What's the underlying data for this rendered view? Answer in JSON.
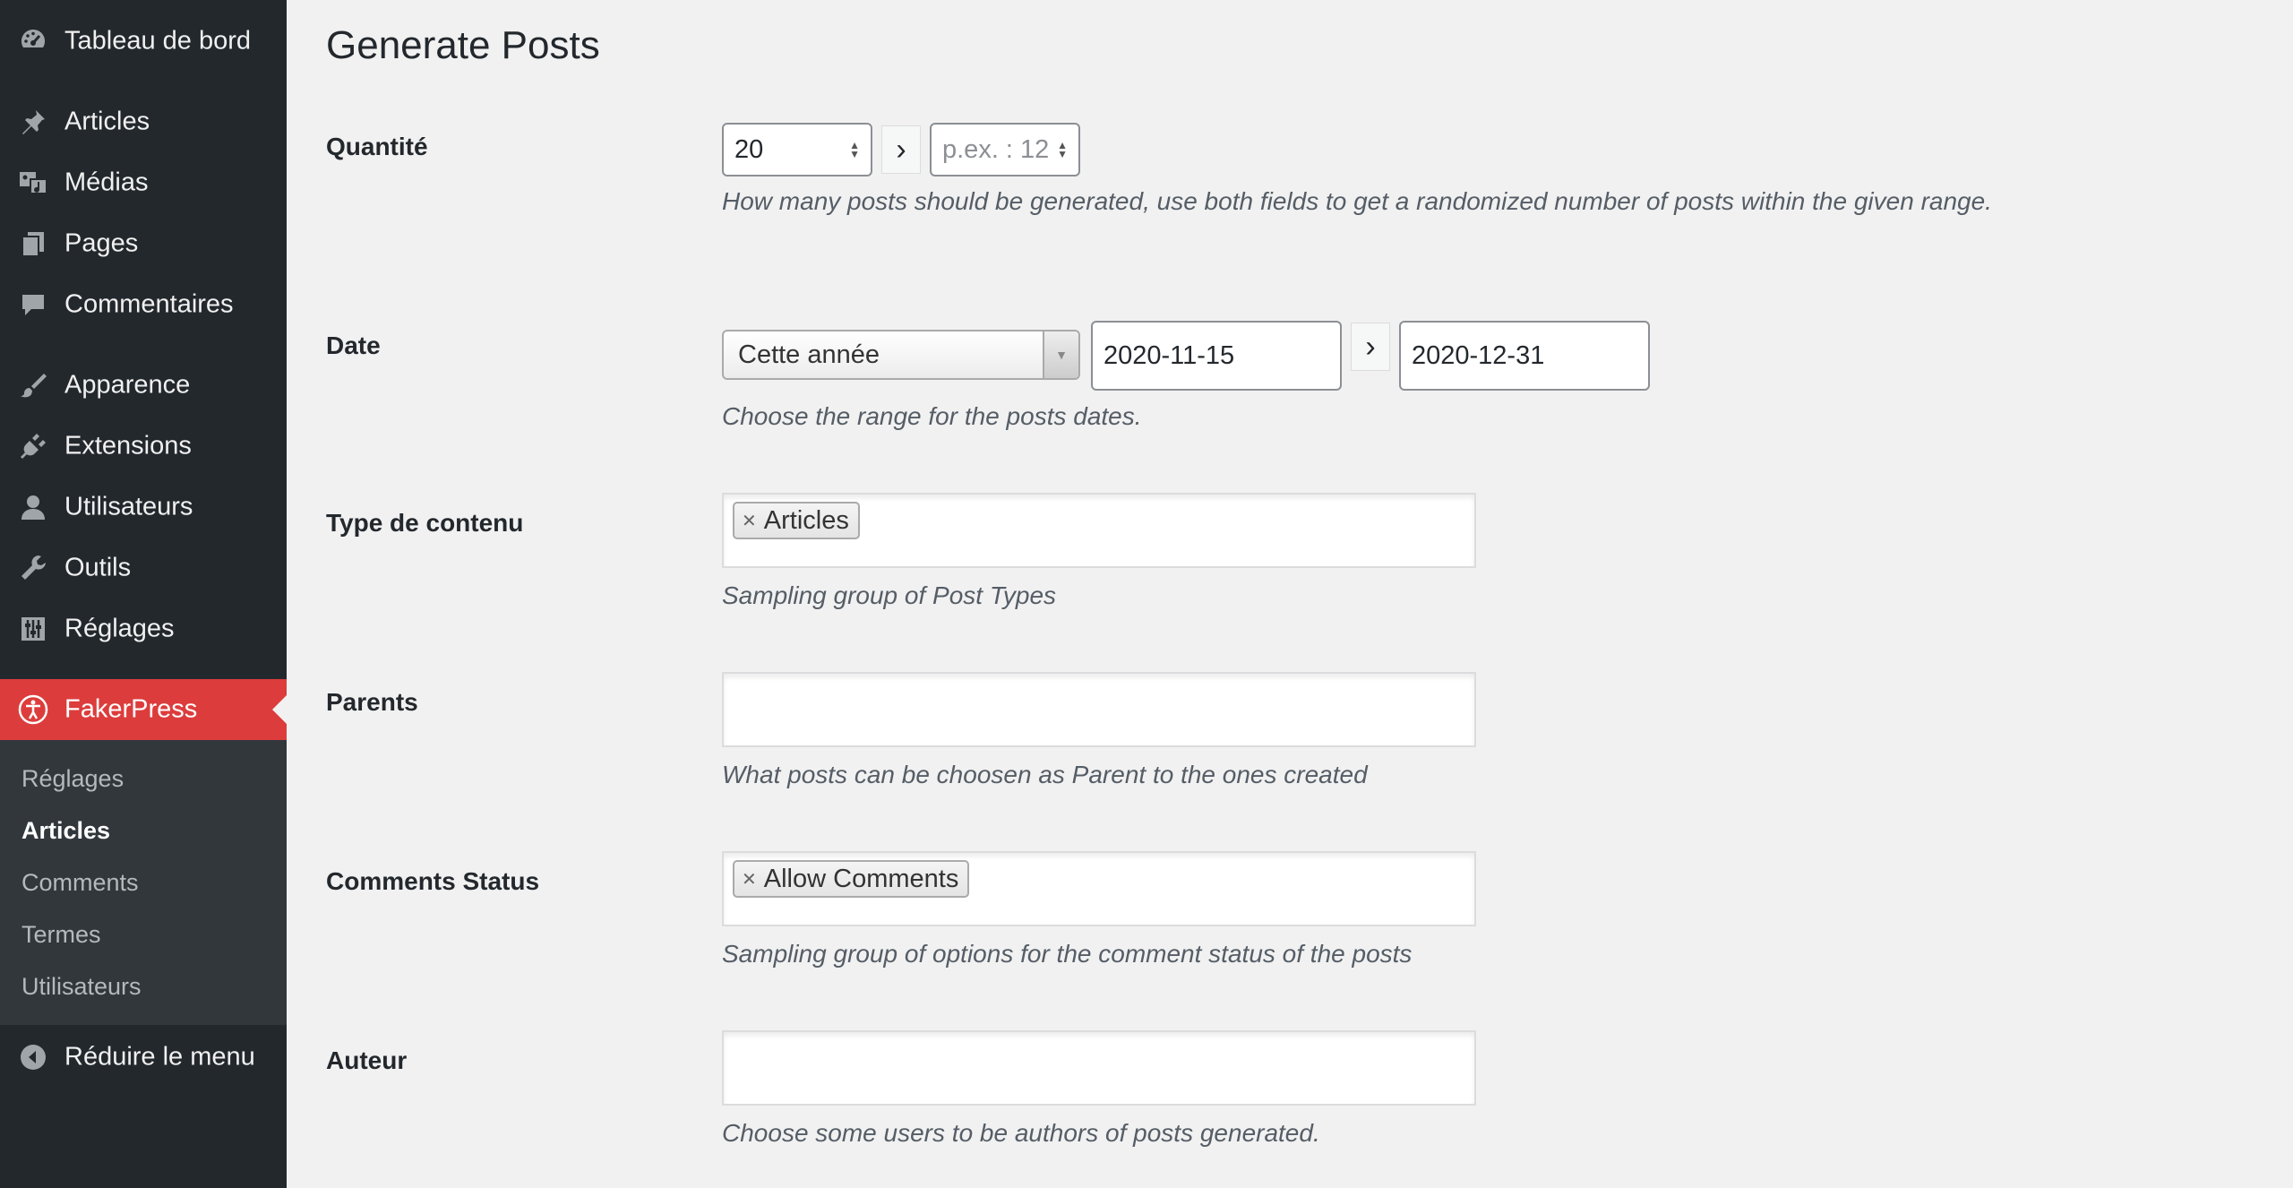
{
  "sidebar": {
    "dashboard": "Tableau de bord",
    "articles": "Articles",
    "medias": "Médias",
    "pages": "Pages",
    "comments": "Commentaires",
    "appearance": "Apparence",
    "plugins": "Extensions",
    "users": "Utilisateurs",
    "tools": "Outils",
    "settings": "Réglages",
    "fakerpress": "FakerPress",
    "submenu": [
      "Réglages",
      "Articles",
      "Comments",
      "Termes",
      "Utilisateurs"
    ],
    "submenu_current": "Articles",
    "collapse": "Réduire le menu"
  },
  "page": {
    "title": "Generate Posts"
  },
  "form": {
    "quantity": {
      "label": "Quantité",
      "min_value": "20",
      "max_placeholder": "p.ex. : 12",
      "description": "How many posts should be generated, use both fields to get a randomized number of posts within the given range."
    },
    "date": {
      "label": "Date",
      "preset": "Cette année",
      "start": "2020-11-15",
      "end": "2020-12-31",
      "description": "Choose the range for the posts dates."
    },
    "post_type": {
      "label": "Type de contenu",
      "tag": "Articles",
      "description": "Sampling group of Post Types"
    },
    "parents": {
      "label": "Parents",
      "description": "What posts can be choosen as Parent to the ones created"
    },
    "comment_status": {
      "label": "Comments Status",
      "tag": "Allow Comments",
      "description": "Sampling group of options for the comment status of the posts"
    },
    "author": {
      "label": "Auteur",
      "description": "Choose some users to be authors of posts generated."
    }
  },
  "icons": {
    "dashboard": "dashboard-icon",
    "articles": "pin-icon",
    "medias": "media-icon",
    "pages": "pages-icon",
    "comments": "comment-icon",
    "appearance": "brush-icon",
    "plugins": "plugin-icon",
    "users": "user-icon",
    "tools": "wrench-icon",
    "settings": "settings-icon",
    "fakerpress": "accessibility-icon",
    "collapse": "collapse-icon"
  },
  "colors": {
    "sidebar_bg": "#23282d",
    "submenu_bg": "#32373c",
    "active_bg": "#dd3c3c",
    "page_bg": "#f1f1f1"
  }
}
